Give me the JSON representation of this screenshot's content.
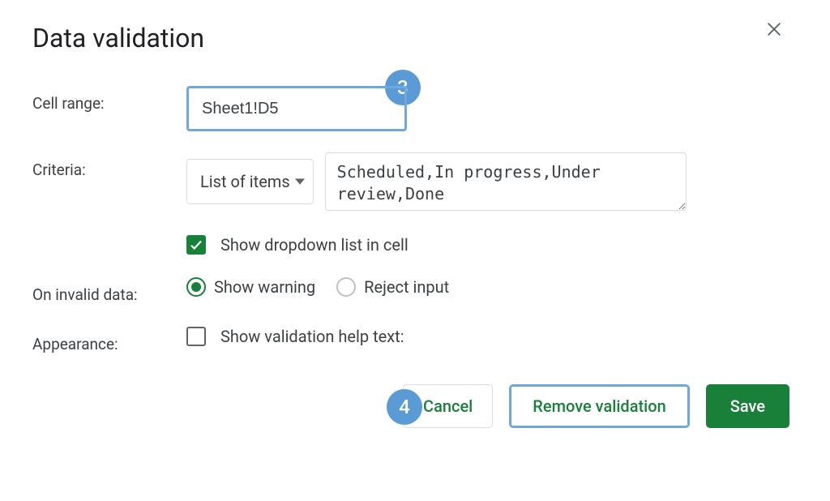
{
  "dialog": {
    "title": "Data validation",
    "annotations": {
      "badge_3": "3",
      "badge_4": "4"
    }
  },
  "fields": {
    "cell_range": {
      "label": "Cell range:",
      "value": "Sheet1!D5"
    },
    "criteria": {
      "label": "Criteria:",
      "dropdown_label": "List of items",
      "items_value": "Scheduled,In progress,Under review,Done"
    },
    "show_dropdown": {
      "label": "Show dropdown list in cell",
      "checked": true
    },
    "on_invalid": {
      "label": "On invalid data:",
      "options": {
        "warning": "Show warning",
        "reject": "Reject input"
      },
      "selected": "warning"
    },
    "appearance": {
      "label": "Appearance:",
      "help_text_label": "Show validation help text:",
      "checked": false
    }
  },
  "buttons": {
    "cancel": "Cancel",
    "remove": "Remove validation",
    "save": "Save"
  }
}
